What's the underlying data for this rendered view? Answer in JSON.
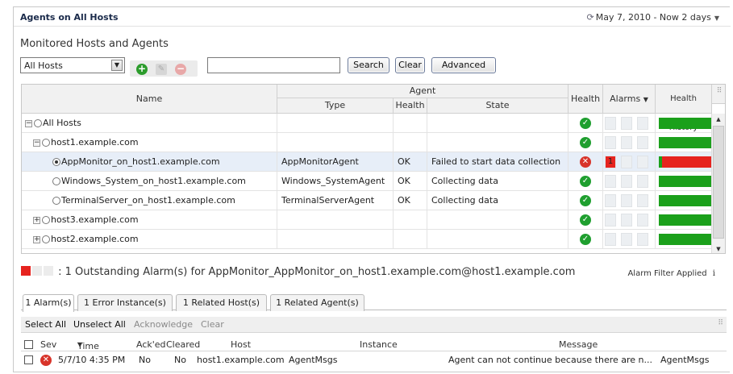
{
  "window": {
    "title": "Agents on All Hosts",
    "timerange": "May 7, 2010 - Now 2 days",
    "timerange_icon": "clock-icon"
  },
  "section_title": "Monitored Hosts and Agents",
  "toolbar": {
    "host_select": "All Hosts",
    "search_value": "",
    "search_label": "Search",
    "clear_label": "Clear",
    "advanced_label": "Advanced"
  },
  "grid": {
    "headers": {
      "name": "Name",
      "agent_group": "Agent",
      "type": "Type",
      "agent_health": "Health",
      "state": "State",
      "health": "Health",
      "alarms": "Alarms",
      "health_history": "Health History"
    },
    "rows": [
      {
        "name": "All Hosts",
        "type": "",
        "agent_health": "",
        "state": "",
        "alarm": ""
      },
      {
        "name": "host1.example.com",
        "type": "",
        "agent_health": "",
        "state": "",
        "alarm": ""
      },
      {
        "name": "AppMonitor_on_host1.example.com",
        "type": "AppMonitorAgent",
        "agent_health": "OK",
        "state": "Failed to start data collection",
        "alarm": "1"
      },
      {
        "name": "Windows_System_on_host1.example.com",
        "type": "Windows_SystemAgent",
        "agent_health": "OK",
        "state": "Collecting data",
        "alarm": ""
      },
      {
        "name": "TerminalServer_on_host1.example.com",
        "type": "TerminalServerAgent",
        "agent_health": "OK",
        "state": "Collecting data",
        "alarm": ""
      },
      {
        "name": "host3.example.com",
        "type": "",
        "agent_health": "",
        "state": "",
        "alarm": ""
      },
      {
        "name": "host2.example.com",
        "type": "",
        "agent_health": "",
        "state": "",
        "alarm": ""
      }
    ]
  },
  "alarm_summary": {
    "text": ": 1 Outstanding Alarm(s) for AppMonitor_AppMonitor_on_host1.example.com@host1.example.com",
    "filter_label": "Alarm Filter",
    "filter_status": "Applied",
    "info_icon": "info-icon"
  },
  "tabs": [
    "1 Alarm(s)",
    "1 Error Instance(s)",
    "1 Related Host(s)",
    "1 Related Agent(s)"
  ],
  "actions": {
    "select_all": "Select All",
    "unselect_all": "Unselect All",
    "acknowledge": "Acknowledge",
    "clear": "Clear"
  },
  "alarm_table": {
    "headers": {
      "sev": "Sev",
      "time": "Time",
      "acked": "Ack'ed",
      "cleared": "Cleared",
      "host": "Host",
      "instance": "Instance",
      "message": "Message"
    },
    "row": {
      "time": "5/7/10 4:35 PM",
      "acked": "No",
      "cleared": "No",
      "host": "host1.example.com",
      "instance": "AgentMsgs",
      "message": "Agent can not continue because there are n...",
      "extra": "AgentMsgs"
    }
  },
  "colors": {
    "ok": "#1f9f2f",
    "error": "#d8342a",
    "alarm_red": "#e6231e",
    "history_green": "#1ba01b"
  }
}
